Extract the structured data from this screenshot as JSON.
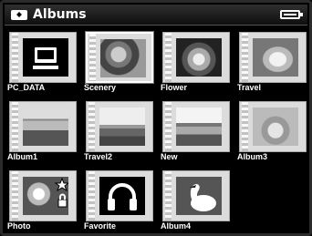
{
  "header": {
    "title": "Albums",
    "album_icon": "album-icon",
    "battery_icon": "battery-icon",
    "battery_level": 1.0
  },
  "albums": [
    {
      "label": "PC_DATA",
      "icon": "computer-icon"
    },
    {
      "label": "Scenery",
      "icon": "flowers-photo",
      "selected": true
    },
    {
      "label": "Flower",
      "icon": "flower-photo"
    },
    {
      "label": "Travel",
      "icon": "animal-photo"
    },
    {
      "label": "Album1",
      "icon": "building-photo"
    },
    {
      "label": "Travel2",
      "icon": "field-photo"
    },
    {
      "label": "New",
      "icon": "landscape-photo"
    },
    {
      "label": "Album3",
      "icon": "cat-photo"
    },
    {
      "label": "Photo",
      "icon": "star-lock-photo"
    },
    {
      "label": "Favorite",
      "icon": "headphones-icon"
    },
    {
      "label": "Album4",
      "icon": "bird-photo"
    }
  ]
}
